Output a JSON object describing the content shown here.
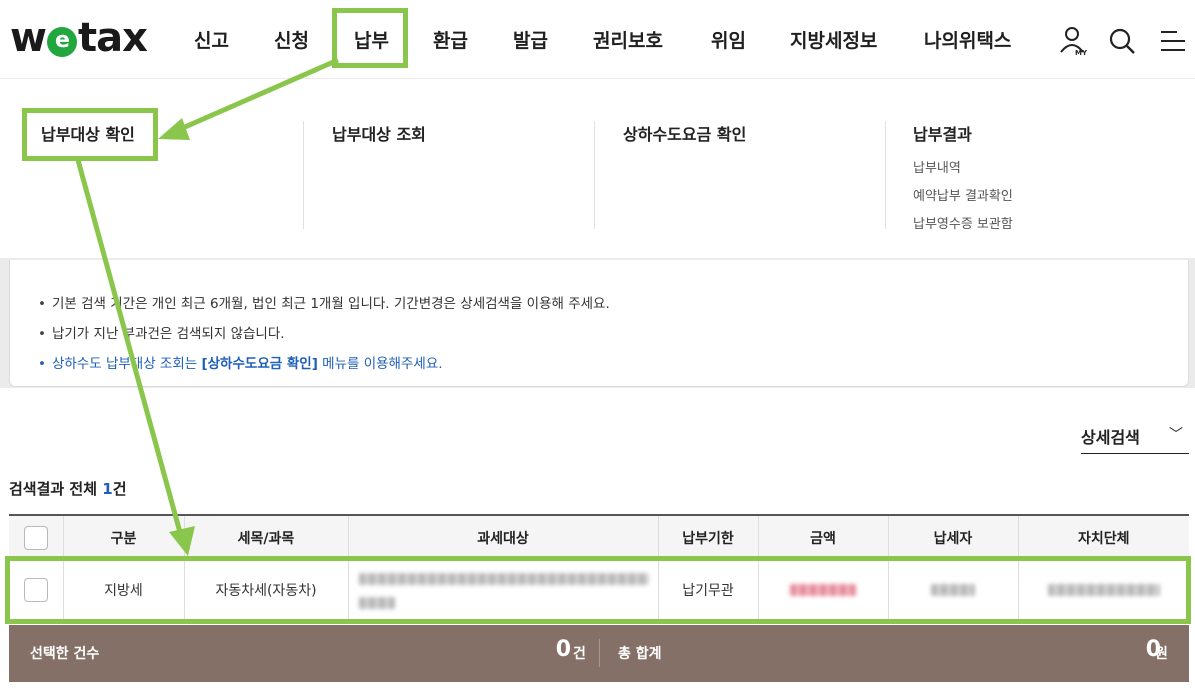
{
  "header": {
    "logo": {
      "prefix": "w",
      "e": "e",
      "suffix": "tax"
    },
    "nav": [
      "신고",
      "신청",
      "납부",
      "환급",
      "발급",
      "권리보호",
      "위임",
      "지방세정보",
      "나의위택스"
    ],
    "icons": {
      "my": "MY"
    }
  },
  "mega": {
    "col1": {
      "title": "납부대상 확인"
    },
    "col2": {
      "title": "납부대상 조회"
    },
    "col3": {
      "title": "상하수도요금 확인"
    },
    "col4": {
      "title": "납부결과",
      "items": [
        "납부내역",
        "예약납부 결과확인",
        "납부영수증 보관함"
      ]
    }
  },
  "notice": {
    "line1": "기본 검색 기간은 개인 최근 6개월, 법인 최근 1개월 입니다. 기간변경은 상세검색을 이용해 주세요.",
    "line2": "납기가 지난 부과건은 검색되지 않습니다.",
    "line3_a": "상하수도 납부대상 조회는 ",
    "line3_b": "[상하수도요금 확인]",
    "line3_c": " 메뉴를 이용해주세요."
  },
  "detail_search": {
    "label": "상세검색",
    "chevron": "﹀"
  },
  "result": {
    "label": "검색결과 전체 ",
    "count": "1",
    "unit": "건"
  },
  "table": {
    "headers": [
      "구분",
      "세목/과목",
      "과세대상",
      "납부기한",
      "금액",
      "납세자",
      "자치단체"
    ],
    "rows": [
      {
        "category": "지방세",
        "tax_item": "자동차세(자동차)",
        "deadline": "납기무관"
      }
    ]
  },
  "footer": {
    "selected_label": "선택한 건수",
    "selected_value": "0",
    "selected_unit": "건",
    "total_label": "총 합계",
    "total_value": "0",
    "total_unit": "원"
  },
  "colors": {
    "highlight": "#8ac64b",
    "accent_blue": "#1f5fb8",
    "footer_bg": "#857067",
    "logo_green": "#22a73f"
  }
}
